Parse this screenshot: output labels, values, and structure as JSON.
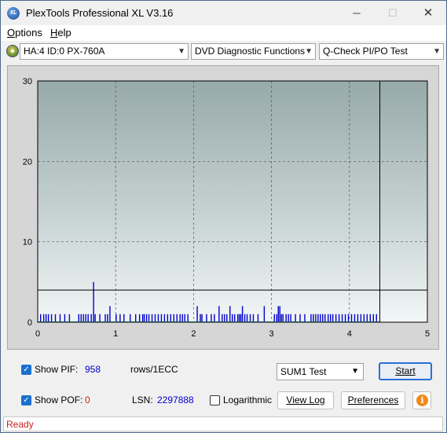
{
  "window": {
    "title": "PlexTools Professional XL V3.16",
    "icon_label": "XL",
    "controls": {
      "minimize": "─",
      "maximize": "☐",
      "close": "✕"
    }
  },
  "menu": [
    {
      "label": "Options",
      "accel": "O"
    },
    {
      "label": "Help",
      "accel": "H"
    }
  ],
  "toolbar": {
    "drive": "HA:4 ID:0  PX-760A",
    "function": "DVD Diagnostic Functions",
    "test": "Q-Check PI/PO Test"
  },
  "chart_data": {
    "type": "bar",
    "xlim": [
      0,
      5
    ],
    "ylim": [
      0,
      30
    ],
    "x_ticks": [
      "0",
      "1",
      "2",
      "3",
      "4",
      "5"
    ],
    "y_ticks": [
      "0",
      "10",
      "20",
      "30"
    ],
    "grid": true,
    "threshold": 4,
    "end_marker_x": 4.39,
    "series": [
      {
        "color": "#0000cc",
        "points": [
          [
            0.03,
            1
          ],
          [
            0.07,
            1
          ],
          [
            0.1,
            1
          ],
          [
            0.13,
            1
          ],
          [
            0.17,
            1
          ],
          [
            0.22,
            1
          ],
          [
            0.28,
            1
          ],
          [
            0.34,
            1
          ],
          [
            0.4,
            1
          ],
          [
            0.52,
            1
          ],
          [
            0.55,
            1
          ],
          [
            0.58,
            1
          ],
          [
            0.61,
            1
          ],
          [
            0.64,
            1
          ],
          [
            0.68,
            1
          ],
          [
            0.71,
            5
          ],
          [
            0.73,
            1
          ],
          [
            0.79,
            1
          ],
          [
            0.86,
            1
          ],
          [
            0.89,
            1
          ],
          [
            0.92,
            2
          ],
          [
            1.0,
            1
          ],
          [
            1.05,
            1
          ],
          [
            1.1,
            1
          ],
          [
            1.18,
            1
          ],
          [
            1.25,
            1
          ],
          [
            1.3,
            1
          ],
          [
            1.34,
            1
          ],
          [
            1.36,
            1
          ],
          [
            1.39,
            1
          ],
          [
            1.42,
            1
          ],
          [
            1.46,
            1
          ],
          [
            1.5,
            1
          ],
          [
            1.54,
            1
          ],
          [
            1.58,
            1
          ],
          [
            1.62,
            1
          ],
          [
            1.66,
            1
          ],
          [
            1.7,
            1
          ],
          [
            1.74,
            1
          ],
          [
            1.78,
            1
          ],
          [
            1.82,
            1
          ],
          [
            1.85,
            1
          ],
          [
            1.88,
            1
          ],
          [
            1.92,
            1
          ],
          [
            2.04,
            2
          ],
          [
            2.08,
            1
          ],
          [
            2.1,
            1
          ],
          [
            2.16,
            1
          ],
          [
            2.22,
            1
          ],
          [
            2.26,
            1
          ],
          [
            2.32,
            2
          ],
          [
            2.36,
            1
          ],
          [
            2.39,
            1
          ],
          [
            2.42,
            1
          ],
          [
            2.46,
            2
          ],
          [
            2.49,
            1
          ],
          [
            2.52,
            1
          ],
          [
            2.56,
            1
          ],
          [
            2.58,
            1
          ],
          [
            2.6,
            1
          ],
          [
            2.62,
            2
          ],
          [
            2.65,
            1
          ],
          [
            2.68,
            1
          ],
          [
            2.72,
            1
          ],
          [
            2.76,
            1
          ],
          [
            2.82,
            1
          ],
          [
            2.9,
            2
          ],
          [
            3.03,
            1
          ],
          [
            3.06,
            1
          ],
          [
            3.08,
            2
          ],
          [
            3.1,
            2
          ],
          [
            3.12,
            1
          ],
          [
            3.14,
            1
          ],
          [
            3.18,
            1
          ],
          [
            3.21,
            1
          ],
          [
            3.24,
            1
          ],
          [
            3.3,
            1
          ],
          [
            3.36,
            1
          ],
          [
            3.42,
            1
          ],
          [
            3.5,
            1
          ],
          [
            3.53,
            1
          ],
          [
            3.56,
            1
          ],
          [
            3.59,
            1
          ],
          [
            3.62,
            1
          ],
          [
            3.65,
            1
          ],
          [
            3.68,
            1
          ],
          [
            3.72,
            1
          ],
          [
            3.75,
            1
          ],
          [
            3.78,
            1
          ],
          [
            3.82,
            1
          ],
          [
            3.86,
            1
          ],
          [
            3.9,
            1
          ],
          [
            3.94,
            1
          ],
          [
            3.98,
            1
          ],
          [
            4.02,
            1
          ],
          [
            4.06,
            1
          ],
          [
            4.1,
            1
          ],
          [
            4.14,
            1
          ],
          [
            4.18,
            1
          ],
          [
            4.22,
            1
          ],
          [
            4.26,
            1
          ],
          [
            4.3,
            1
          ],
          [
            4.34,
            1
          ]
        ]
      }
    ]
  },
  "controls": {
    "show_pif_label": "Show PIF:",
    "pif_value": "958",
    "units": "rows/1ECC",
    "show_pof_label": "Show POF:",
    "pof_value": "0",
    "lsn_label": "LSN:",
    "lsn_value": "2297888",
    "logarithmic_label": "Logarithmic",
    "sum_select": "SUM1 Test",
    "start_label": "Start",
    "view_log_label": "View Log",
    "preferences_label": "Preferences",
    "check_mark": "✓",
    "info_glyph": "i"
  },
  "status": {
    "text": "Ready"
  },
  "colors": {
    "accent": "#2a6fd6",
    "bars": "#0000cc",
    "status": "#d02020",
    "pif_value": "#0000cc",
    "pof_value": "#d02020"
  }
}
